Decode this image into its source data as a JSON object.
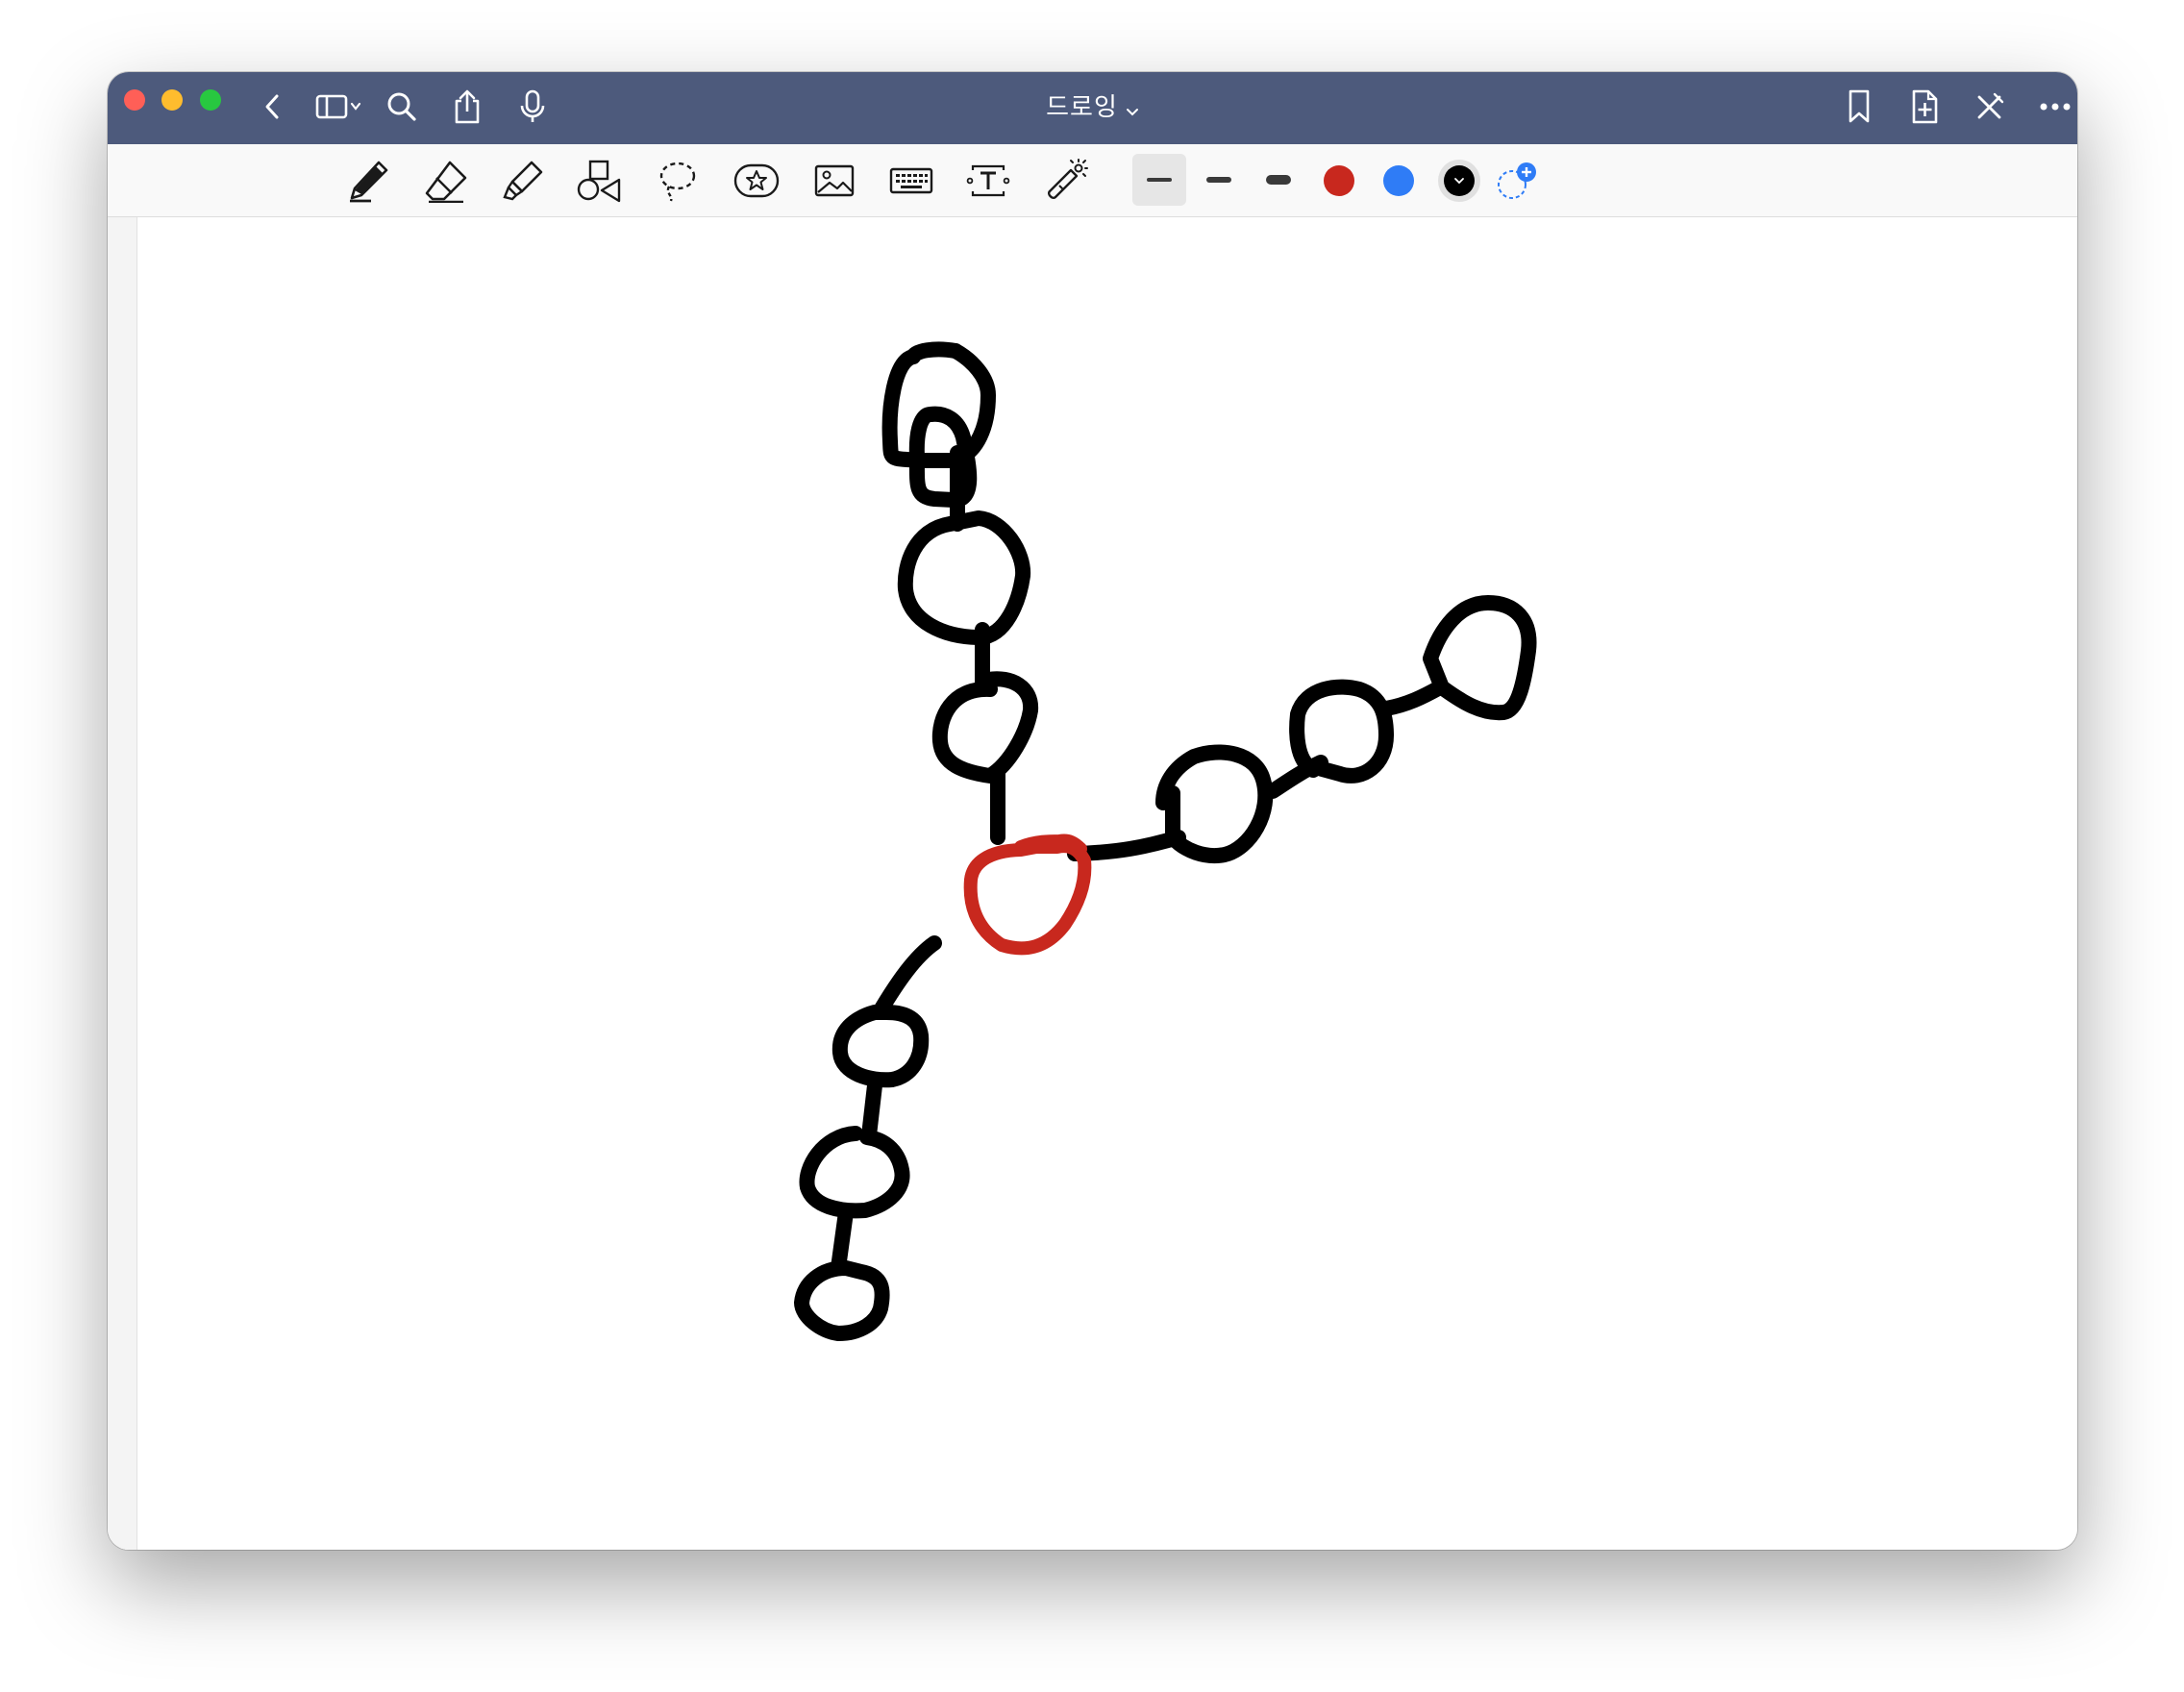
{
  "window": {
    "title": "드로잉",
    "header_color": "#4d5a7c"
  },
  "titlebar": {
    "left_icons": [
      "back-chevron-icon",
      "sidebar-toggle-icon",
      "search-icon",
      "share-icon",
      "microphone-icon"
    ],
    "right_icons": [
      "bookmark-icon",
      "add-page-icon",
      "close-drawing-icon",
      "more-icon"
    ]
  },
  "toolbar": {
    "tools": [
      "pen-icon",
      "eraser-icon",
      "highlighter-icon",
      "shapes-icon",
      "lasso-icon",
      "sticker-icon",
      "image-icon",
      "keyboard-icon",
      "text-box-icon",
      "laser-pointer-icon"
    ],
    "thickness_options": [
      "thin",
      "medium",
      "thick"
    ],
    "selected_thickness": "thin",
    "colors": [
      "#c8281e",
      "#2f7cf6",
      "#000000"
    ],
    "selected_color": "#000000",
    "add_color_icon": "add-color-icon"
  },
  "drawing": {
    "stroke_color": "#000000",
    "highlight_color": "#c8281e",
    "center_node": "red-circle"
  }
}
